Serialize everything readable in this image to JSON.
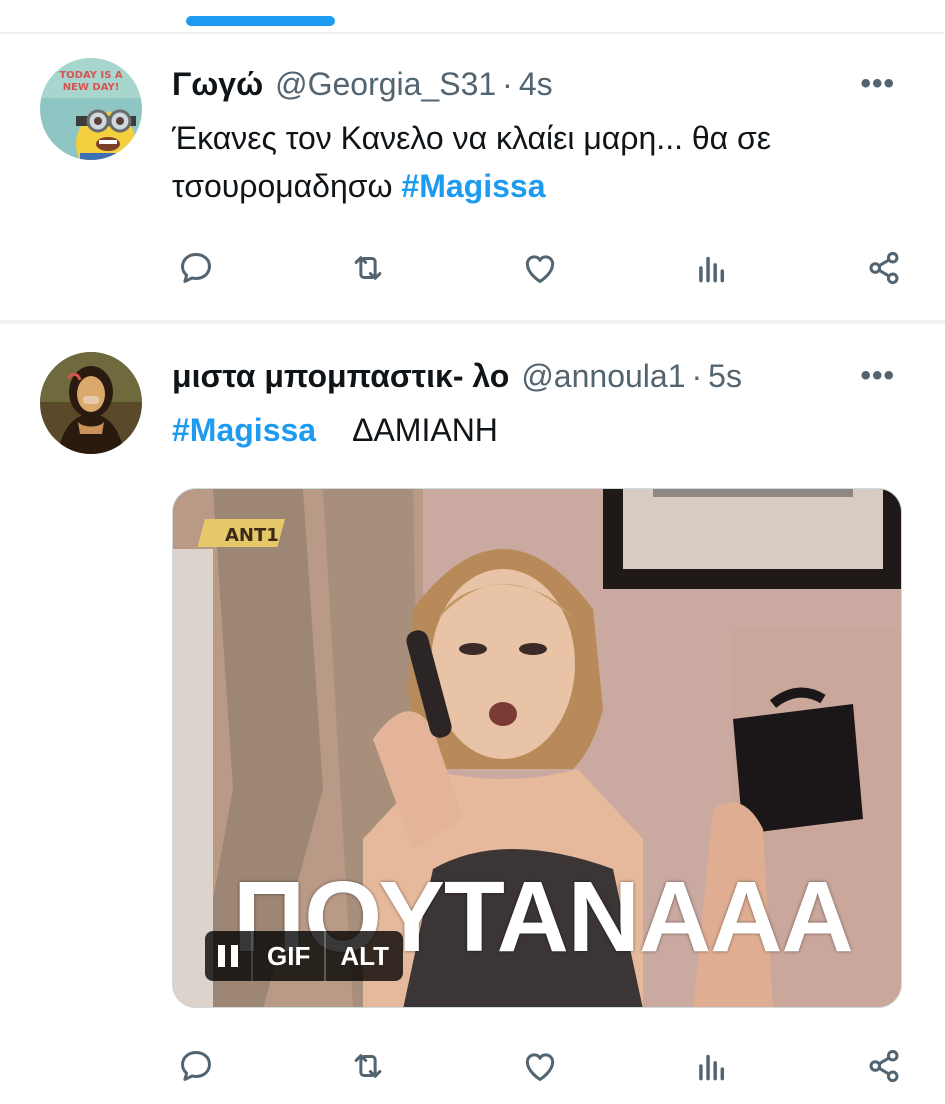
{
  "colors": {
    "accent": "#1d9bf0",
    "text_primary": "#0f1419",
    "text_secondary": "#536471",
    "divider": "#eff3f4"
  },
  "tweets": [
    {
      "display_name": "Γωγώ",
      "handle": "@Georgia_S31",
      "separator": "·",
      "time": "4s",
      "more_icon": "more-horizontal-icon",
      "text_plain": "Έκανες τον Κανελο να κλαίει μαρη... θα σε τσουρομαδησω ",
      "hashtag": "#Magissa",
      "avatar_icon": "minion-avatar",
      "avatar_text": "TODAY IS A NEW DAY!"
    },
    {
      "display_name": "μιστα μπομπαστικ- λο",
      "handle": "@annoula1",
      "separator": "·",
      "time": "5s",
      "more_icon": "more-horizontal-icon",
      "hashtag": "#Magissa",
      "text_plain": "ΔΑΜΙΑΝΗ",
      "avatar_icon": "mona-lisa-avatar",
      "media": {
        "caption": "ΠΟΥΤΑΝΑΑΑ",
        "channel_logo": "ANT1",
        "gif_label": "GIF",
        "alt_label": "ALT",
        "pause_icon": "pause-icon"
      }
    }
  ],
  "actions": [
    {
      "name": "reply",
      "icon": "reply-icon"
    },
    {
      "name": "retweet",
      "icon": "retweet-icon"
    },
    {
      "name": "like",
      "icon": "heart-icon"
    },
    {
      "name": "views",
      "icon": "analytics-icon"
    },
    {
      "name": "share",
      "icon": "share-icon"
    }
  ]
}
